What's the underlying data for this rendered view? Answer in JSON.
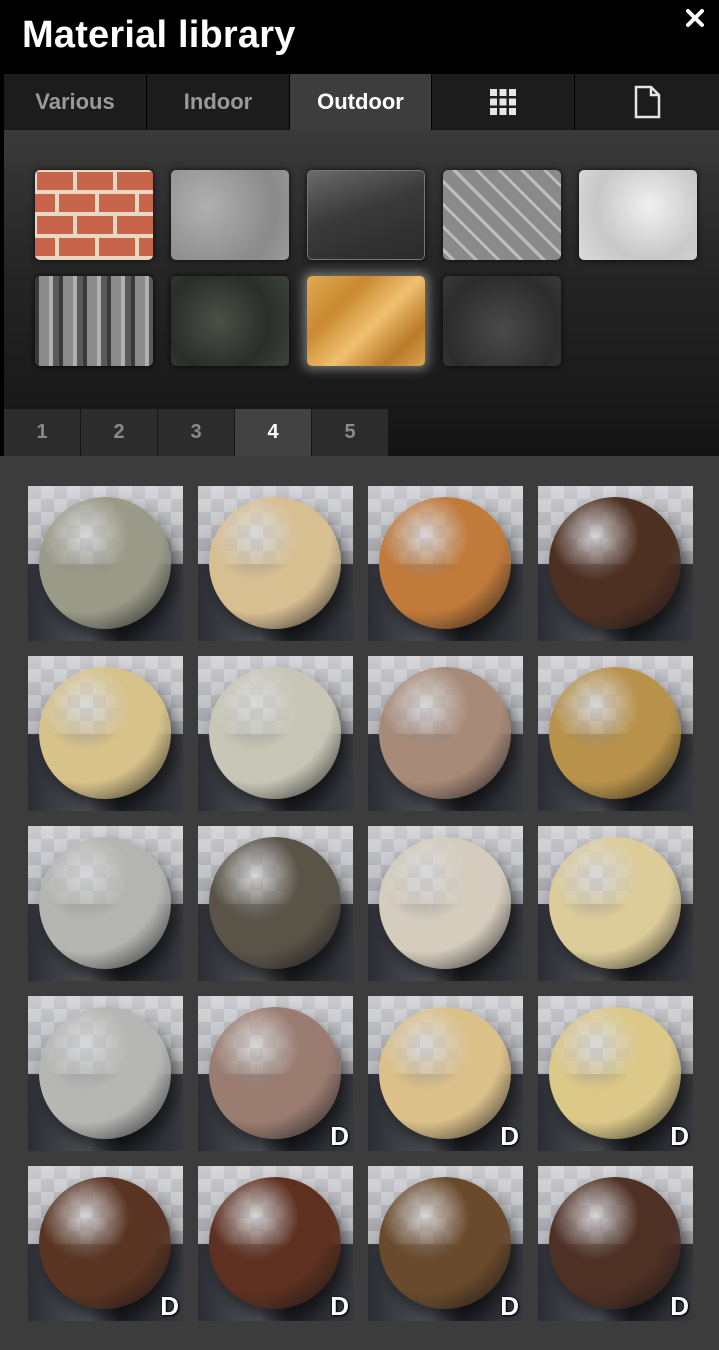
{
  "window": {
    "title": "Material library",
    "close_icon": "close-icon"
  },
  "tabs": [
    {
      "label": "Various",
      "active": false
    },
    {
      "label": "Indoor",
      "active": false
    },
    {
      "label": "Outdoor",
      "active": true
    },
    {
      "label": "",
      "icon": "grid-icon",
      "active": false
    },
    {
      "label": "",
      "icon": "document-icon",
      "active": false
    }
  ],
  "categories": [
    {
      "name": "brick",
      "selected": false
    },
    {
      "name": "concrete",
      "selected": false
    },
    {
      "name": "glass",
      "selected": false
    },
    {
      "name": "metal-plate",
      "selected": false
    },
    {
      "name": "plaster",
      "selected": false
    },
    {
      "name": "roof-tiles",
      "selected": false
    },
    {
      "name": "stone",
      "selected": false
    },
    {
      "name": "wood-chips",
      "selected": true
    },
    {
      "name": "asphalt",
      "selected": false
    }
  ],
  "pages": [
    {
      "label": "1",
      "active": false
    },
    {
      "label": "2",
      "active": false
    },
    {
      "label": "3",
      "active": false
    },
    {
      "label": "4",
      "active": true
    },
    {
      "label": "5",
      "active": false
    }
  ],
  "materials": [
    {
      "color": "#9a9a88",
      "badge": ""
    },
    {
      "color": "#d8bf92",
      "badge": ""
    },
    {
      "color": "#c07a3a",
      "badge": ""
    },
    {
      "color": "#4e3022",
      "badge": ""
    },
    {
      "color": "#d7c28a",
      "badge": ""
    },
    {
      "color": "#c8c6b6",
      "badge": ""
    },
    {
      "color": "#a88a78",
      "badge": ""
    },
    {
      "color": "#b8924a",
      "badge": ""
    },
    {
      "color": "#b4b4b0",
      "badge": ""
    },
    {
      "color": "#5a5448",
      "badge": ""
    },
    {
      "color": "#d4ccbc",
      "badge": ""
    },
    {
      "color": "#dccc9a",
      "badge": ""
    },
    {
      "color": "#b6b6b4",
      "badge": ""
    },
    {
      "color": "#9a7c70",
      "badge": "D"
    },
    {
      "color": "#dcc08a",
      "badge": "D"
    },
    {
      "color": "#dcc888",
      "badge": "D"
    },
    {
      "color": "#5a3422",
      "badge": "D"
    },
    {
      "color": "#5e3020",
      "badge": "D"
    },
    {
      "color": "#6a4a2c",
      "badge": "D"
    },
    {
      "color": "#4e3024",
      "badge": "D"
    }
  ]
}
